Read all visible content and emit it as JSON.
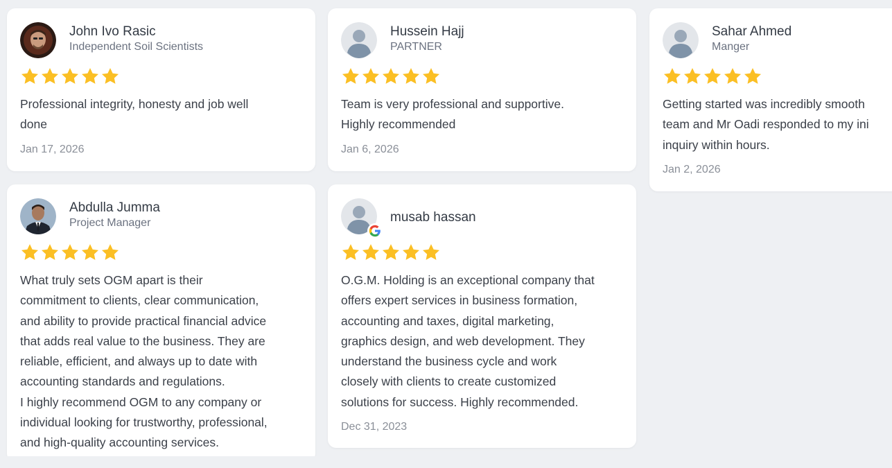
{
  "colors": {
    "page_bg": "#eef0f3",
    "card_bg": "#ffffff",
    "star": "#fbbf24",
    "google_blue": "#4285F4",
    "google_red": "#EA4335",
    "google_yellow": "#FBBC05",
    "google_green": "#34A853"
  },
  "reviews": [
    {
      "name": "John Ivo Rasic",
      "role": "Independent Soil Scientists",
      "rating": 5,
      "text": "Professional integrity, honesty and job well\ndone",
      "date": "Jan 17, 2026",
      "avatar": "photo-avatar"
    },
    {
      "name": "Hussein Hajj",
      "role": "PARTNER",
      "rating": 5,
      "text": "Team is very professional and supportive.\nHighly recommended",
      "date": "Jan 6, 2026",
      "avatar": "default-avatar"
    },
    {
      "name": "Sahar Ahmed",
      "role": "Manger",
      "rating": 5,
      "text": "Getting started was incredibly smooth\nteam and Mr Oadi responded to my ini\ninquiry within hours.",
      "date": "Jan 2, 2026",
      "avatar": "default-avatar"
    },
    {
      "name": "Abdulla Jumma",
      "role": "Project Manager",
      "rating": 5,
      "text": "What truly sets OGM apart is their\ncommitment to clients, clear communication,\nand ability to provide practical financial advice\nthat adds real value to the business. They are\nreliable, efficient, and always up to date with\naccounting standards and regulations.\nI highly recommend OGM to any company or\nindividual looking for trustworthy, professional,\nand high-quality accounting services.",
      "date": "",
      "avatar": "photo-avatar"
    },
    {
      "name": "musab hassan",
      "role": "",
      "rating": 5,
      "text": "O.G.M. Holding is an exceptional company that\noffers expert services in business formation,\naccounting and taxes, digital marketing,\ngraphics design, and web development. They\nunderstand the business cycle and work\nclosely with clients to create customized\nsolutions for success. Highly recommended.",
      "date": "Dec 31, 2023",
      "avatar": "default-avatar",
      "source_icon": "google-icon"
    }
  ]
}
